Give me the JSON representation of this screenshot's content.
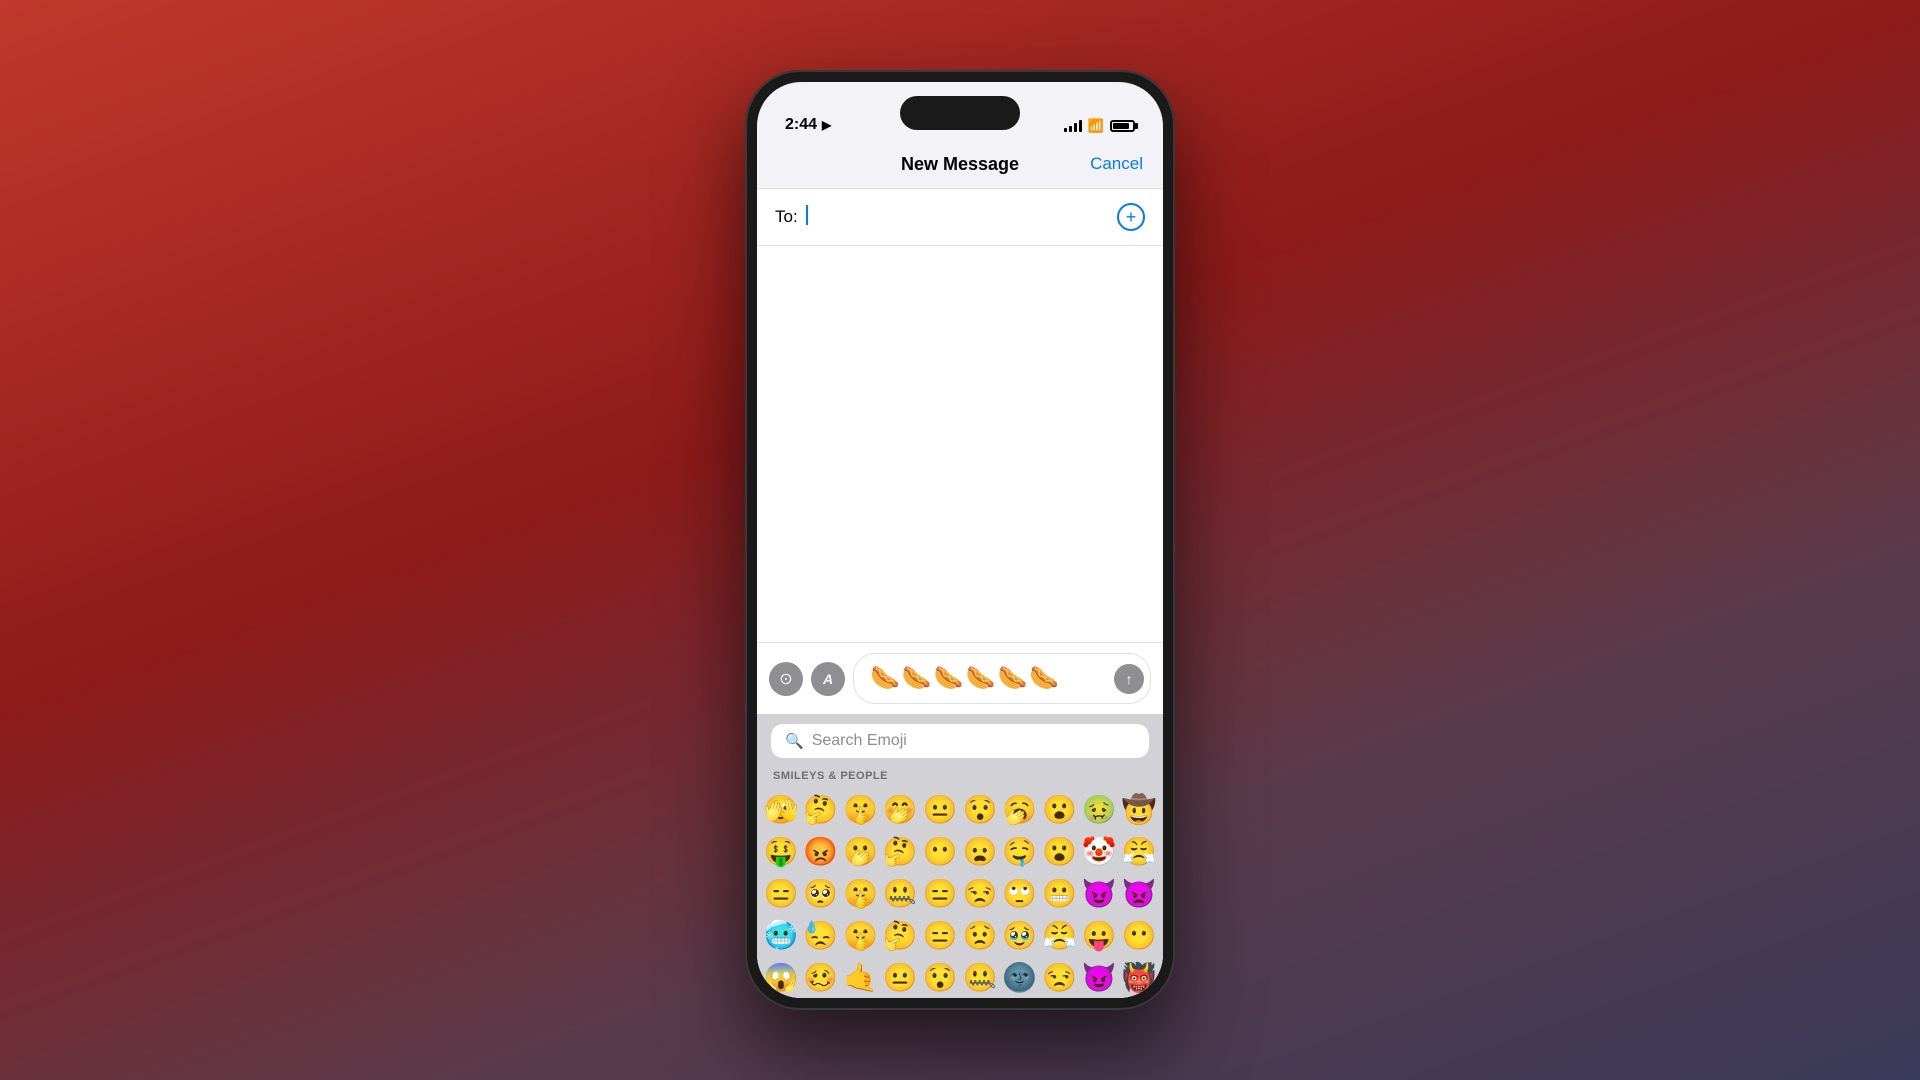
{
  "status": {
    "time": "2:44",
    "location_arrow": "➤"
  },
  "nav": {
    "title": "New Message",
    "cancel": "Cancel"
  },
  "to_field": {
    "label": "To:",
    "placeholder": ""
  },
  "message_input": {
    "content": "🌭🌭🌭🌭🌭🌭"
  },
  "emoji": {
    "search_placeholder": "Search Emoji",
    "category_label": "SMILEYS & PEOPLE",
    "rows": [
      [
        "🫣",
        "🤔",
        "🤫",
        "🤭",
        "😐",
        "😯",
        "🥱",
        "😮",
        "🤢",
        "🤠"
      ],
      [
        "🤑",
        "😡",
        "🫢",
        "🤔",
        "😶",
        "😦",
        "🤤",
        "😮",
        "🤡",
        "😤"
      ],
      [
        "😑",
        "🥺",
        "🤫",
        "🤐",
        "😑",
        "😒",
        "🙄",
        "😬",
        "😈",
        "👿"
      ],
      [
        "🥶",
        "😓",
        "🤫",
        "🤔",
        "😑",
        "😟",
        "🥹",
        "😤",
        "😛",
        "😶"
      ],
      [
        "😱",
        "🥴",
        "🤙",
        "😐",
        "😯",
        "🤐",
        "🌚",
        "😒",
        "😈",
        "👹"
      ]
    ]
  },
  "buttons": {
    "camera_icon": "📷",
    "app_icon": "A",
    "send_icon": "↑"
  }
}
